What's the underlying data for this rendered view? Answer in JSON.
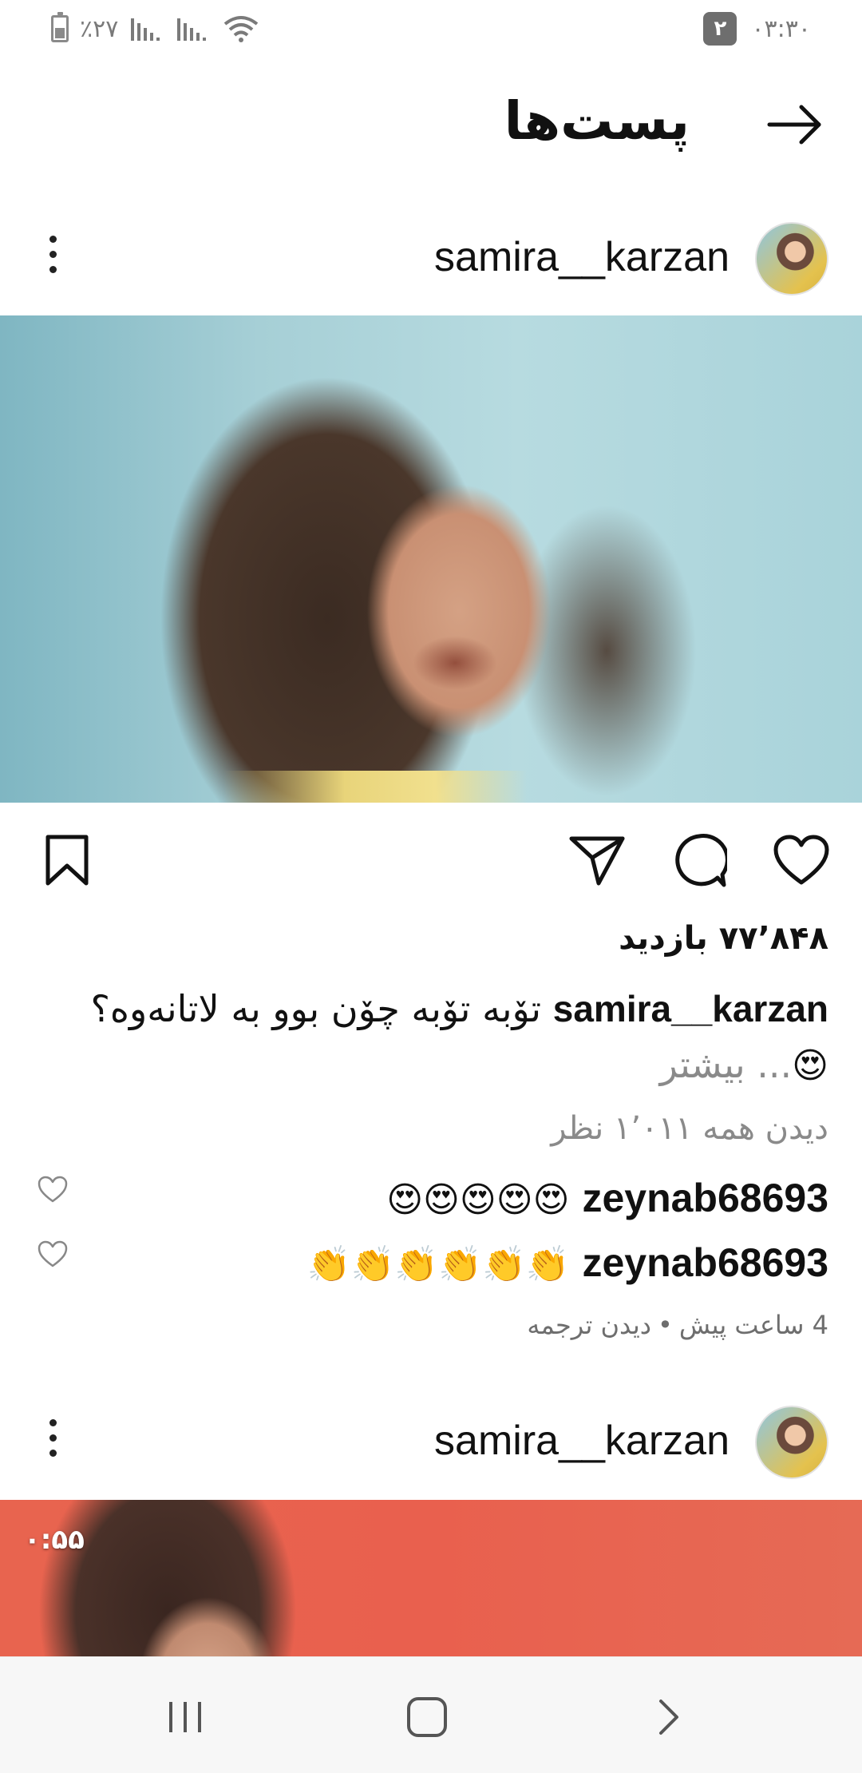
{
  "status_bar": {
    "battery_text": "٪۲۷",
    "notification_count": "۲",
    "clock": "۰۳:۳۰",
    "icons": [
      "battery-icon",
      "signal-icon",
      "signal-icon",
      "wifi-icon"
    ]
  },
  "header": {
    "title": "پست‌ها",
    "back_icon": "arrow-right-icon"
  },
  "posts": [
    {
      "username": "samira__karzan",
      "more_icon": "vertical-ellipsis-icon",
      "media_type": "image"
    },
    {
      "username": "samira__karzan",
      "more_icon": "vertical-ellipsis-icon",
      "media_type": "video",
      "video_duration": "۰:۵۵"
    }
  ],
  "actions": {
    "icons": [
      "heart-icon",
      "comment-icon",
      "share-icon",
      "bookmark-icon"
    ]
  },
  "post_details": {
    "views": "۷۷٬۸۴۸ بازدید",
    "caption_user": "samira__karzan",
    "caption_text": "تۆبە تۆبە چۆن بوو بە لاتانەوە؟",
    "caption_emoji": "😍",
    "more_label": "... بیشتر",
    "view_all_comments": "دیدن همه ۱٬۰۱۱ نظر",
    "comments": [
      {
        "user": "zeynab68693",
        "text": "😍😍😍😍😍"
      },
      {
        "user": "zeynab68693",
        "text": "👏👏👏👏👏👏"
      }
    ],
    "time_ago": "4 ساعت پیش",
    "separator": "•",
    "see_translation": "دیدن ترجمه"
  },
  "nav_bar": {
    "icons": [
      "recent-apps-icon",
      "home-icon",
      "back-icon"
    ]
  },
  "colors": {
    "text": "#111111",
    "secondary_text": "#8a8a8a",
    "nav_background": "#f7f7f7"
  }
}
